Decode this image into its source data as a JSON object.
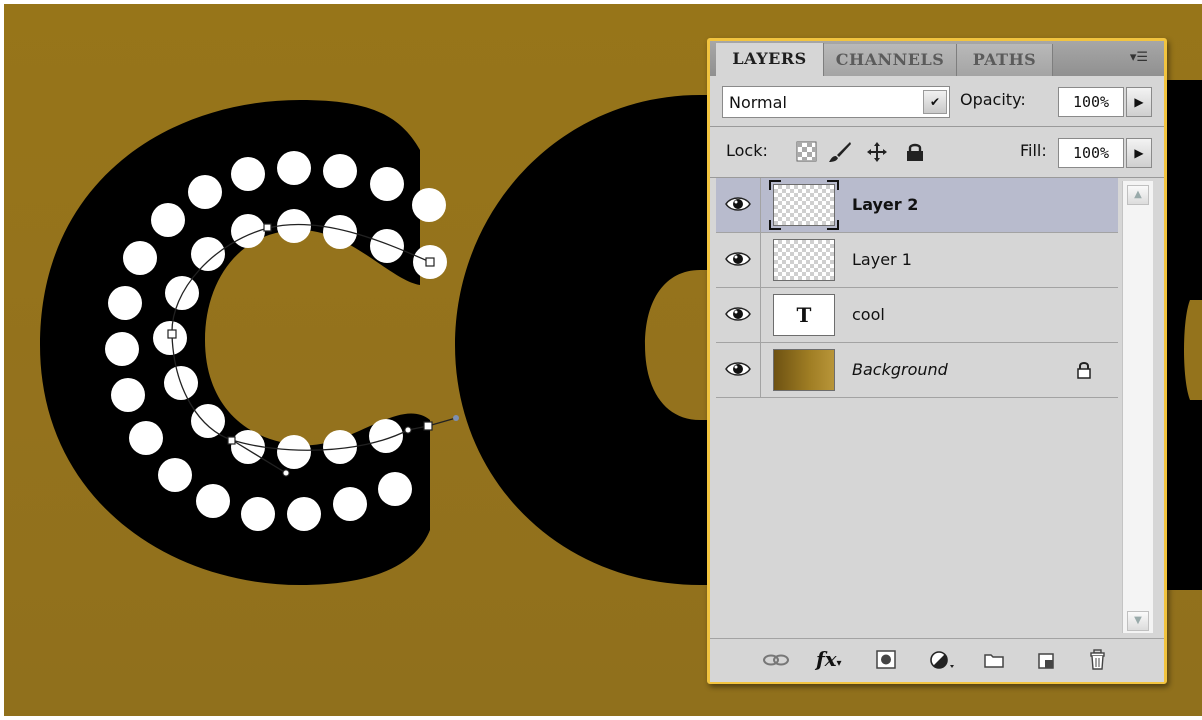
{
  "canvas": {
    "text_art": "coo",
    "background_color": "#95741c"
  },
  "panel": {
    "tabs": [
      {
        "label": "LAYERS",
        "active": true
      },
      {
        "label": "CHANNELS",
        "active": false
      },
      {
        "label": "PATHS",
        "active": false
      }
    ],
    "menu_icon": "panel-menu-icon",
    "blend_mode": "Normal",
    "opacity_label": "Opacity:",
    "opacity_value": "100%",
    "lock_label": "Lock:",
    "lock_icons": [
      "lock-transparent-icon",
      "lock-paint-icon",
      "lock-move-icon",
      "lock-all-icon"
    ],
    "fill_label": "Fill:",
    "fill_value": "100%",
    "layers": [
      {
        "name": "Layer 2",
        "thumb": "transparent",
        "visible": true,
        "selected": true
      },
      {
        "name": "Layer 1",
        "thumb": "transparent",
        "visible": true,
        "selected": false
      },
      {
        "name": "cool",
        "thumb": "text",
        "thumb_glyph": "T",
        "visible": true,
        "selected": false
      },
      {
        "name": "Background",
        "thumb": "gradient",
        "visible": true,
        "selected": false,
        "locked": true
      }
    ],
    "footer_icons": [
      "link-layers-icon",
      "fx-icon",
      "add-mask-icon",
      "adjustment-layer-icon",
      "new-group-icon",
      "new-layer-icon",
      "trash-icon"
    ],
    "fx_label": "fx",
    "colors": {
      "border": "#f2c43f",
      "selected_row": "#b8bbcd",
      "panel_bg": "#d6d6d6"
    }
  }
}
